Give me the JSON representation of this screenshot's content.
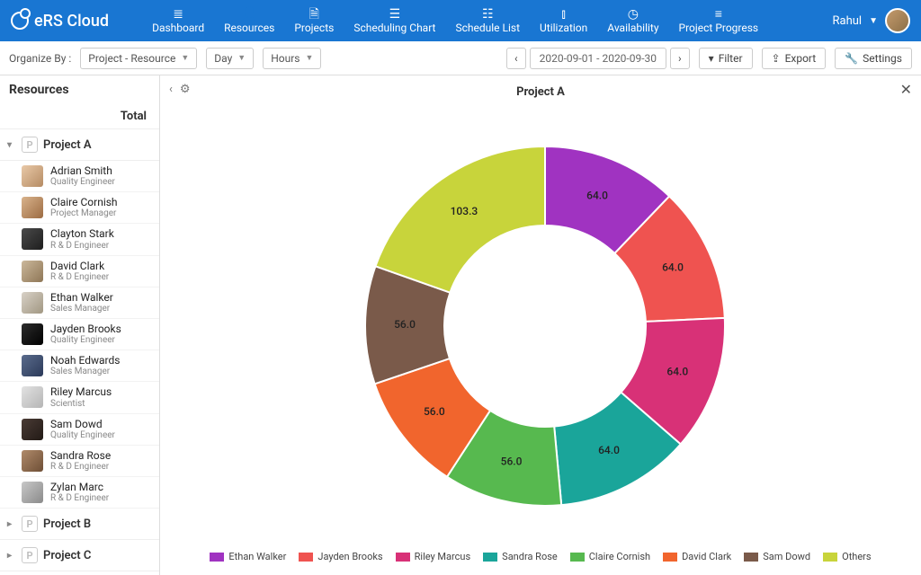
{
  "brand": "eRS Cloud",
  "nav": [
    {
      "label": "Dashboard",
      "icon": "≣"
    },
    {
      "label": "Resources",
      "icon": "👤"
    },
    {
      "label": "Projects",
      "icon": "🗎"
    },
    {
      "label": "Scheduling Chart",
      "icon": "☰"
    },
    {
      "label": "Schedule List",
      "icon": "☷"
    },
    {
      "label": "Utilization",
      "icon": "⫾",
      "active": true
    },
    {
      "label": "Availability",
      "icon": "◷"
    },
    {
      "label": "Project Progress",
      "icon": "≡"
    }
  ],
  "user": {
    "name": "Rahul"
  },
  "toolbar": {
    "organize_label": "Organize By :",
    "organize_value": "Project - Resource",
    "period": "Day",
    "units": "Hours",
    "date_range": "2020-09-01 - 2020-09-30",
    "filter": "Filter",
    "export": "Export",
    "settings": "Settings"
  },
  "sidebar": {
    "title": "Resources",
    "total_label": "Total",
    "projects": [
      {
        "name": "Project A",
        "expanded": true
      },
      {
        "name": "Project B",
        "expanded": false
      },
      {
        "name": "Project C",
        "expanded": false
      }
    ],
    "resources": [
      {
        "name": "Adrian Smith",
        "role": "Quality Engineer"
      },
      {
        "name": "Claire Cornish",
        "role": "Project Manager"
      },
      {
        "name": "Clayton Stark",
        "role": "R & D Engineer"
      },
      {
        "name": "David Clark",
        "role": "R & D Engineer"
      },
      {
        "name": "Ethan Walker",
        "role": "Sales Manager"
      },
      {
        "name": "Jayden Brooks",
        "role": "Quality Engineer"
      },
      {
        "name": "Noah Edwards",
        "role": "Sales Manager"
      },
      {
        "name": "Riley Marcus",
        "role": "Scientist"
      },
      {
        "name": "Sam Dowd",
        "role": "Quality Engineer"
      },
      {
        "name": "Sandra Rose",
        "role": "R & D Engineer"
      },
      {
        "name": "Zylan Marc",
        "role": "R & D Engineer"
      }
    ]
  },
  "chart_data": {
    "type": "pie",
    "title": "Project A",
    "series": [
      {
        "name": "Ethan Walker",
        "value": 64.0,
        "color": "#a033c1",
        "label": "64.0"
      },
      {
        "name": "Jayden Brooks",
        "value": 64.0,
        "color": "#ef5350",
        "label": "64.0"
      },
      {
        "name": "Riley Marcus",
        "value": 64.0,
        "color": "#d83177",
        "label": "64.0"
      },
      {
        "name": "Sandra Rose",
        "value": 64.0,
        "color": "#1aa59a",
        "label": "64.0"
      },
      {
        "name": "Claire Cornish",
        "value": 56.0,
        "color": "#57b94f",
        "label": "56.0"
      },
      {
        "name": "David Clark",
        "value": 56.0,
        "color": "#f1652d",
        "label": "56.0"
      },
      {
        "name": "Sam Dowd",
        "value": 56.0,
        "color": "#7a5a4a",
        "label": "56.0"
      },
      {
        "name": "Others",
        "value": 103.3,
        "color": "#c8d43b",
        "label": "103.3"
      }
    ]
  }
}
